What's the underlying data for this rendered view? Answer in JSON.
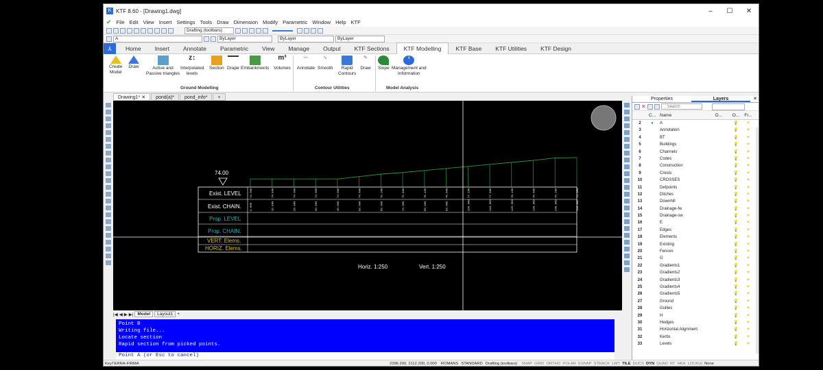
{
  "window": {
    "title": "KTF 8.60 - [Drawing1.dwg]"
  },
  "menu": [
    "File",
    "Edit",
    "View",
    "Insert",
    "Settings",
    "Tools",
    "Draw",
    "Dimension",
    "Modify",
    "Parametric",
    "Window",
    "Help",
    "KTF"
  ],
  "toolbar": {
    "workspace": "Drafting (toolbars)",
    "layer": "A",
    "color": "ByLayer",
    "linetype": "ByLayer",
    "lineweight": "ByLayer"
  },
  "ribbon_tabs": [
    "Home",
    "Insert",
    "Annotate",
    "Parametric",
    "View",
    "Manage",
    "Output",
    "KTF Sections",
    "KTF Modelling",
    "KTF Base",
    "KTF Utilities",
    "KTF Design"
  ],
  "ribbon": {
    "buttons": [
      {
        "label": "Create\nModel"
      },
      {
        "label": "Draw"
      },
      {
        "label": "Active and\nPassive triangles"
      },
      {
        "label": "Interpolated\nlevels"
      },
      {
        "label": "Section"
      },
      {
        "label": "Drape"
      },
      {
        "label": "Embankments"
      },
      {
        "label": "Volumes"
      },
      {
        "label": "Annotate"
      },
      {
        "label": "Smooth"
      },
      {
        "label": "Rapid\nContours"
      },
      {
        "label": "Draw"
      },
      {
        "label": "Slope"
      },
      {
        "label": "Management and\nInformation"
      }
    ],
    "groups": [
      "Ground Modelling",
      "Contour Utilities",
      "Model Analysis"
    ]
  },
  "doc_tabs": [
    "Drawing1*",
    "pond(a)*",
    "pond_info*"
  ],
  "drawing": {
    "level_marker": "74.00",
    "rows": [
      "Exist. LEVEL",
      "Exist. CHAIN.",
      "Prop. LEVEL",
      "Prop. CHAIN.",
      "VERT. Elems.",
      "HORIZ. Elems."
    ],
    "scale": {
      "horiz": "Horiz.  1:250",
      "vert": "Vert.   1:250"
    },
    "ground_profile": [
      {
        "chain": 0,
        "level": 74.0
      },
      {
        "chain": 10,
        "level": 74.0
      },
      {
        "chain": 20,
        "level": 74.0
      },
      {
        "chain": 30,
        "level": 74.0
      },
      {
        "chain": 40,
        "level": 74.0
      },
      {
        "chain": 50,
        "level": 74.6
      },
      {
        "chain": 60,
        "level": 75.2
      },
      {
        "chain": 70,
        "level": 75.6
      },
      {
        "chain": 80,
        "level": 76.1
      },
      {
        "chain": 90,
        "level": 76.6
      },
      {
        "chain": 100,
        "level": 77.1
      },
      {
        "chain": 110,
        "level": 77.6
      },
      {
        "chain": 120,
        "level": 78.1
      },
      {
        "chain": 130,
        "level": 78.6
      },
      {
        "chain": 140,
        "level": 79.2
      },
      {
        "chain": 150,
        "level": 79.3
      }
    ]
  },
  "layout_tabs": [
    "Model",
    "Layout1"
  ],
  "command": {
    "history": [
      "Point B",
      "Writing file...",
      "Locate section",
      "Rapid section from picked points."
    ],
    "prompt": "Point A (or Esc to cancel)"
  },
  "status": {
    "license": "KeyTERRA-FIRMA",
    "coords": "2396.200, 2112.200, 0.000",
    "text_style": "ROMANS",
    "dim_style": "STANDARD",
    "workspace": "Drafting (toolbars)",
    "toggles": [
      "SNAP",
      "GRID",
      "ORTHO",
      "POLAR",
      "ESNAP",
      "STRACK",
      "LWT",
      "TILE",
      "DUCS",
      "DYN",
      "QUAD",
      "RT",
      "HKA",
      "LOCKUI",
      "None"
    ]
  },
  "panel": {
    "tabs": [
      "Properties",
      "Layers"
    ],
    "search_placeholder": "Search",
    "columns": [
      "C...",
      "Name",
      "D...",
      "O...",
      "Fr..."
    ],
    "layers": [
      {
        "num": "2",
        "name": "A"
      },
      {
        "num": "3",
        "name": "Annotation"
      },
      {
        "num": "4",
        "name": "BT"
      },
      {
        "num": "5",
        "name": "Buildings"
      },
      {
        "num": "6",
        "name": "Channels"
      },
      {
        "num": "7",
        "name": "Codes"
      },
      {
        "num": "8",
        "name": "Construction"
      },
      {
        "num": "9",
        "name": "Crests"
      },
      {
        "num": "10",
        "name": "CROSSES"
      },
      {
        "num": "11",
        "name": "Defpoints"
      },
      {
        "num": "12",
        "name": "Ditches"
      },
      {
        "num": "13",
        "name": "Downhill"
      },
      {
        "num": "14",
        "name": "Drainage-fw"
      },
      {
        "num": "15",
        "name": "Drainage-sw"
      },
      {
        "num": "16",
        "name": "E"
      },
      {
        "num": "17",
        "name": "Edges"
      },
      {
        "num": "18",
        "name": "Elements"
      },
      {
        "num": "19",
        "name": "Existing"
      },
      {
        "num": "20",
        "name": "Fences"
      },
      {
        "num": "21",
        "name": "G"
      },
      {
        "num": "22",
        "name": "Gradients1"
      },
      {
        "num": "23",
        "name": "Gradients2"
      },
      {
        "num": "24",
        "name": "Gradients3"
      },
      {
        "num": "25",
        "name": "Gradients4"
      },
      {
        "num": "26",
        "name": "Gradients5"
      },
      {
        "num": "27",
        "name": "Ground"
      },
      {
        "num": "28",
        "name": "Gullies"
      },
      {
        "num": "29",
        "name": "H"
      },
      {
        "num": "30",
        "name": "Hedges"
      },
      {
        "num": "31",
        "name": "Horizontal Alignment"
      },
      {
        "num": "32",
        "name": "Kerbs"
      },
      {
        "num": "33",
        "name": "Levels"
      }
    ]
  },
  "colors": {
    "profile": "#2a9a3a",
    "row_white": "#ffffff",
    "row_teal": "#1fb0b0",
    "row_yellow": "#d8c020",
    "command_bg": "#0000ff"
  }
}
